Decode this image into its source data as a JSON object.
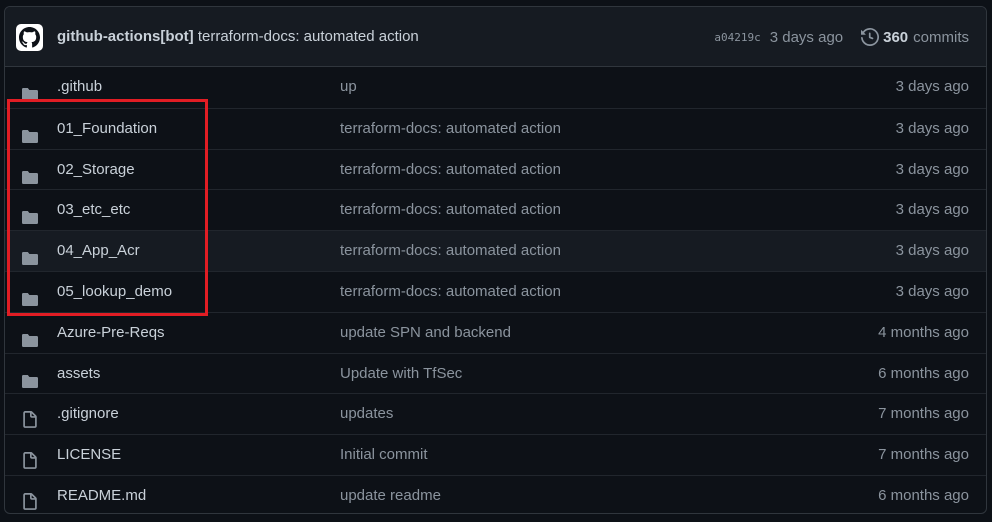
{
  "latest_commit": {
    "author": "github-actions[bot]",
    "message": "terraform-docs: automated action",
    "sha": "a04219c",
    "age": "3 days ago",
    "commit_count": "360",
    "commit_label": "commits"
  },
  "files": [
    {
      "type": "folder",
      "name": ".github",
      "message": "up",
      "age": "3 days ago"
    },
    {
      "type": "folder",
      "name": "01_Foundation",
      "message": "terraform-docs: automated action",
      "age": "3 days ago"
    },
    {
      "type": "folder",
      "name": "02_Storage",
      "message": "terraform-docs: automated action",
      "age": "3 days ago"
    },
    {
      "type": "folder",
      "name": "03_etc_etc",
      "message": "terraform-docs: automated action",
      "age": "3 days ago"
    },
    {
      "type": "folder",
      "name": "04_App_Acr",
      "message": "terraform-docs: automated action",
      "age": "3 days ago"
    },
    {
      "type": "folder",
      "name": "05_lookup_demo",
      "message": "terraform-docs: automated action",
      "age": "3 days ago"
    },
    {
      "type": "folder",
      "name": "Azure-Pre-Reqs",
      "message": "update SPN and backend",
      "age": "4 months ago"
    },
    {
      "type": "folder",
      "name": "assets",
      "message": "Update with TfSec",
      "age": "6 months ago"
    },
    {
      "type": "file",
      "name": ".gitignore",
      "message": "updates",
      "age": "7 months ago"
    },
    {
      "type": "file",
      "name": "LICENSE",
      "message": "Initial commit",
      "age": "7 months ago"
    },
    {
      "type": "file",
      "name": "README.md",
      "message": "update readme",
      "age": "6 months ago"
    }
  ],
  "colors": {
    "background": "#0d1117",
    "header_bg": "#161b22",
    "border": "#30363d",
    "text": "#c9d1d9",
    "muted": "#8b949e",
    "highlight": "#e11d24"
  }
}
